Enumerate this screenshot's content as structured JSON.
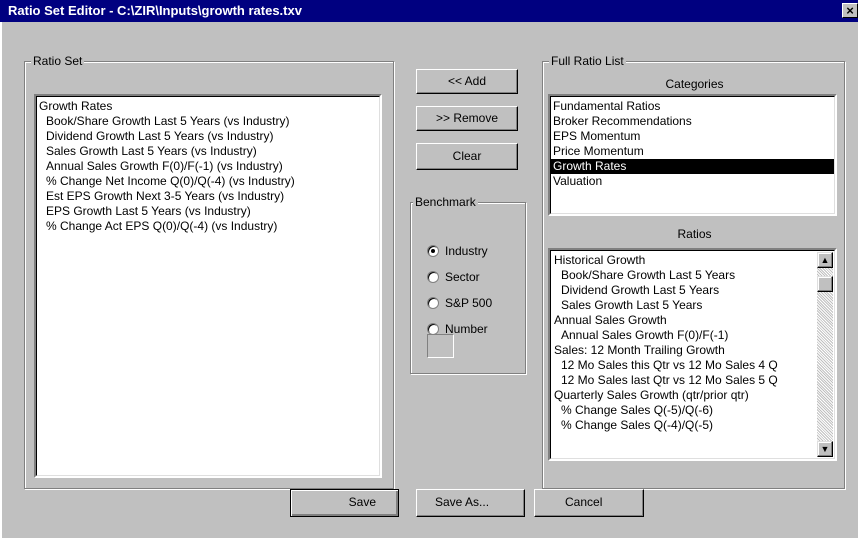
{
  "window": {
    "title": "Ratio Set Editor - C:\\ZIR\\Inputs\\growth rates.txv",
    "close_glyph": "×"
  },
  "ratio_set": {
    "legend": "Ratio Set",
    "items": [
      {
        "text": "Growth Rates",
        "indent": false
      },
      {
        "text": "Book/Share Growth  Last 5 Years (vs Industry)",
        "indent": true
      },
      {
        "text": "Dividend Growth  Last 5 Years (vs Industry)",
        "indent": true
      },
      {
        "text": "Sales Growth  Last 5 Years (vs Industry)",
        "indent": true
      },
      {
        "text": "Annual Sales Growth  F(0)/F(-1) (vs Industry)",
        "indent": true
      },
      {
        "text": "% Change Net Income  Q(0)/Q(-4) (vs Industry)",
        "indent": true
      },
      {
        "text": "Est EPS Growth  Next 3-5 Years (vs Industry)",
        "indent": true
      },
      {
        "text": "EPS Growth  Last 5 Years (vs Industry)",
        "indent": true
      },
      {
        "text": "% Change Act EPS  Q(0)/Q(-4) (vs Industry)",
        "indent": true
      }
    ]
  },
  "actions": {
    "add_label": "<< Add",
    "remove_label": ">> Remove",
    "clear_label": "Clear"
  },
  "benchmark": {
    "legend": "Benchmark",
    "options": [
      {
        "label": "Industry",
        "checked": true
      },
      {
        "label": "Sector",
        "checked": false
      },
      {
        "label": "S&P 500",
        "checked": false
      },
      {
        "label": "Number",
        "checked": false
      }
    ],
    "number_value": ""
  },
  "full_ratio_list": {
    "legend": "Full Ratio List",
    "categories_label": "Categories",
    "categories": [
      {
        "text": "Fundamental Ratios",
        "selected": false
      },
      {
        "text": "Broker Recommendations",
        "selected": false
      },
      {
        "text": "EPS Momentum",
        "selected": false
      },
      {
        "text": "Price Momentum",
        "selected": false
      },
      {
        "text": "Growth Rates",
        "selected": true
      },
      {
        "text": "Valuation",
        "selected": false
      }
    ],
    "ratios_label": "Ratios",
    "ratios": [
      {
        "text": "Historical Growth",
        "indent": false
      },
      {
        "text": "Book/Share Growth  Last 5 Years",
        "indent": true
      },
      {
        "text": "Dividend Growth  Last 5 Years",
        "indent": true
      },
      {
        "text": "Sales Growth  Last 5 Years",
        "indent": true
      },
      {
        "text": "Annual Sales Growth",
        "indent": false
      },
      {
        "text": "Annual Sales Growth  F(0)/F(-1)",
        "indent": true
      },
      {
        "text": "Sales: 12 Month Trailing Growth",
        "indent": false
      },
      {
        "text": "12 Mo Sales this Qtr vs  12 Mo Sales 4 Q",
        "indent": true
      },
      {
        "text": "12 Mo Sales last Qtr vs  12 Mo Sales 5 Q",
        "indent": true
      },
      {
        "text": "Quarterly Sales Growth (qtr/prior qtr)",
        "indent": false
      },
      {
        "text": "% Change Sales  Q(-5)/Q(-6)",
        "indent": true
      },
      {
        "text": "% Change Sales  Q(-4)/Q(-5)",
        "indent": true
      }
    ],
    "scroll_position": 0.05
  },
  "footer": {
    "save_label": "Save",
    "save_as_label": "Save As...",
    "cancel_label": "Cancel"
  },
  "icons": {
    "scroll_up": "▲",
    "scroll_down": "▼",
    "close": "close-icon"
  }
}
